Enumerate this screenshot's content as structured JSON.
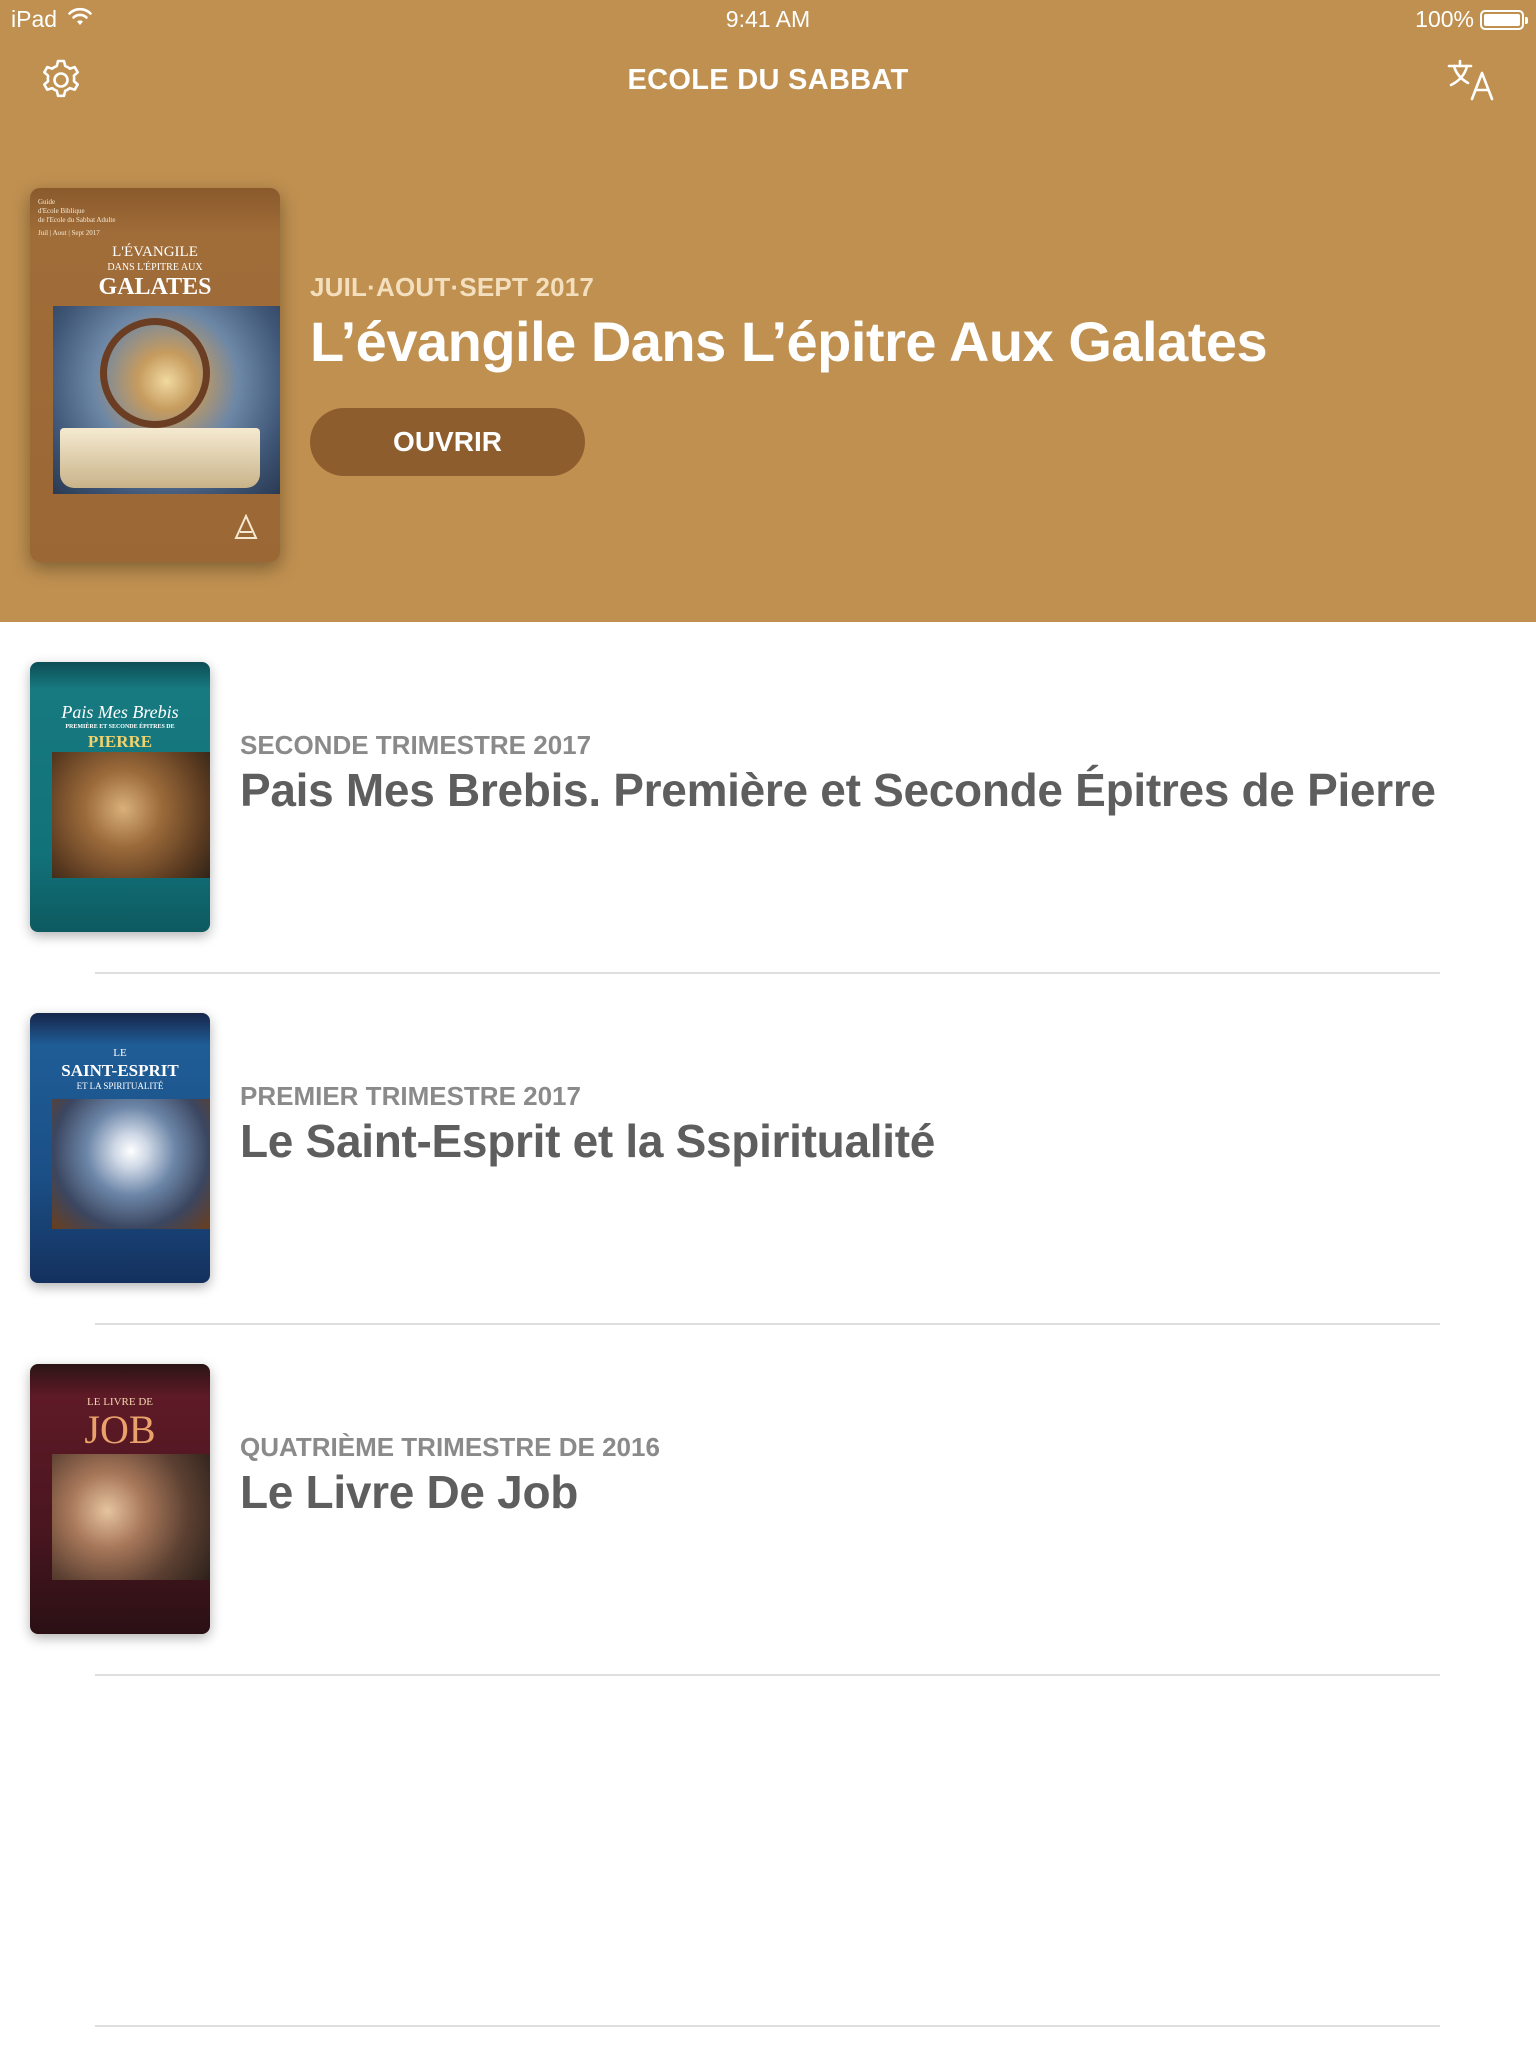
{
  "status_bar": {
    "device": "iPad",
    "time": "9:41 AM",
    "battery": "100%"
  },
  "navbar": {
    "title": "ECOLE DU SABBAT",
    "settings_icon": "gear-icon",
    "language_icon": "translate-icon"
  },
  "featured": {
    "date": "JUIL·AOUT·SEPT 2017",
    "title": "L’évangile Dans L’épitre Aux Galates",
    "open_label": "OUVRIR",
    "cover": {
      "small_text": [
        "Guide",
        "d'Ecole Biblique",
        "de l'Ecole du Sabbat Adulte",
        "Juil | Aout | Sept 2017"
      ],
      "line1": "L'ÉVANGILE",
      "line2": "DANS L'ÉPITRE AUX",
      "line3": "GALATES"
    }
  },
  "items": [
    {
      "date": "SECONDE TRIMESTRE 2017",
      "title": "Pais Mes Brebis. Première et Seconde Épitres de Pierre",
      "cover": {
        "line1": "Pais Mes Brebis",
        "line2": "PREMIÈRE ET SECONDE ÉPITRES DE",
        "line3": "PIERRE"
      }
    },
    {
      "date": "PREMIER TRIMESTRE 2017",
      "title": "Le Saint-Esprit et la Sspiritualité",
      "cover": {
        "line1": "LE",
        "line2": "SAINT-ESPRIT",
        "line3": "ET LA SPIRITUALITÉ"
      }
    },
    {
      "date": "QUATRIÈME TRIMESTRE DE 2016",
      "title": "Le Livre De Job",
      "cover": {
        "line1": "LE LIVRE DE",
        "line2": "JOB"
      }
    }
  ],
  "colors": {
    "accent": "#bf9050",
    "button": "#8d5d2e"
  }
}
